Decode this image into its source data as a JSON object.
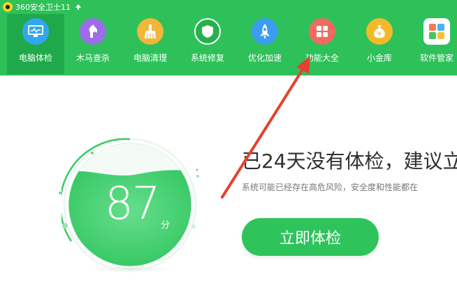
{
  "titlebar": {
    "title": "360安全卫士11"
  },
  "nav": {
    "items": [
      {
        "label": "电脑体检",
        "icon": "monitor-icon",
        "color": "#2fa8f0"
      },
      {
        "label": "木马查杀",
        "icon": "horse-icon",
        "color": "#9b6ee8"
      },
      {
        "label": "电脑清理",
        "icon": "broom-icon",
        "color": "#f2b63a"
      },
      {
        "label": "系统修复",
        "icon": "shield-icon",
        "color": "#27b04e"
      },
      {
        "label": "优化加速",
        "icon": "rocket-icon",
        "color": "#3b9cf0"
      },
      {
        "label": "功能大全",
        "icon": "grid-icon",
        "color": "#f06b5e"
      },
      {
        "label": "小金库",
        "icon": "money-bag-icon",
        "color": "#f4b92a"
      },
      {
        "label": "软件管家",
        "icon": "software-icon",
        "color": "#ffffff"
      }
    ]
  },
  "main": {
    "score": "87",
    "score_unit": "分",
    "headline": "已24天没有体检，建议立",
    "subtext": "系统可能已经存在高危风险，安全度和性能都在",
    "cta_label": "立即体检"
  },
  "colors": {
    "header": "#2ec15a",
    "header_active": "#20a94a",
    "cta": "#2fc35b",
    "arrow": "#e5412f"
  }
}
